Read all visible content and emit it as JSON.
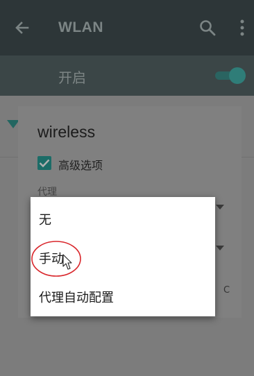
{
  "appbar": {
    "title": "WLAN",
    "back_icon": "arrow-left-icon",
    "search_icon": "search-icon",
    "more_icon": "more-vert-icon"
  },
  "switch": {
    "label": "开启",
    "state": "on"
  },
  "dialog": {
    "title": "wireless",
    "advanced_options": {
      "label": "高级选项",
      "checked": true
    },
    "proxy_label": "代理",
    "partial_text": "C"
  },
  "dropdown": {
    "options": [
      "无",
      "手动",
      "代理自动配置"
    ],
    "highlighted": "手动"
  },
  "colors": {
    "accent": "#1c6c67",
    "annotation": "#d9262b",
    "appbar": "#2d3638"
  }
}
